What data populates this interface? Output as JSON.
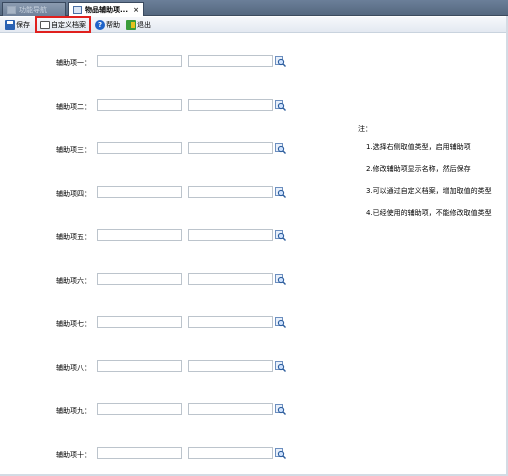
{
  "tabs": [
    {
      "label": "功能导航",
      "active": false
    },
    {
      "label": "物品辅助项...",
      "active": true,
      "close": "×"
    }
  ],
  "toolbar": {
    "save": "保存",
    "custom_archive": "自定义档案",
    "help": "帮助",
    "help_glyph": "?",
    "exit": "退出"
  },
  "fields": [
    {
      "label": "辅助项一：",
      "value1": "",
      "value2": ""
    },
    {
      "label": "辅助项二：",
      "value1": "",
      "value2": ""
    },
    {
      "label": "辅助项三：",
      "value1": "",
      "value2": ""
    },
    {
      "label": "辅助项四：",
      "value1": "",
      "value2": ""
    },
    {
      "label": "辅助项五：",
      "value1": "",
      "value2": ""
    },
    {
      "label": "辅助项六：",
      "value1": "",
      "value2": ""
    },
    {
      "label": "辅助项七：",
      "value1": "",
      "value2": ""
    },
    {
      "label": "辅助项八：",
      "value1": "",
      "value2": ""
    },
    {
      "label": "辅助项九：",
      "value1": "",
      "value2": ""
    },
    {
      "label": "辅助项十：",
      "value1": "",
      "value2": ""
    }
  ],
  "notes": {
    "title": "注：",
    "lines": [
      "1.选择右侧取值类型，启用辅助项",
      "2.修改辅助项显示名称，然后保存",
      "3.可以通过自定义档案，增加取值的类型",
      "4.已经使用的辅助项，不能修改取值类型"
    ]
  },
  "colors": {
    "highlight_border": "#e0201e",
    "tab_bar": "#5f728b",
    "input_border": "#bcc4cc"
  },
  "icons": {
    "save": "save-icon",
    "custom_archive": "folder-icon",
    "help": "help-icon",
    "exit": "exit-icon",
    "field_lookup": "search-lookup-icon"
  }
}
